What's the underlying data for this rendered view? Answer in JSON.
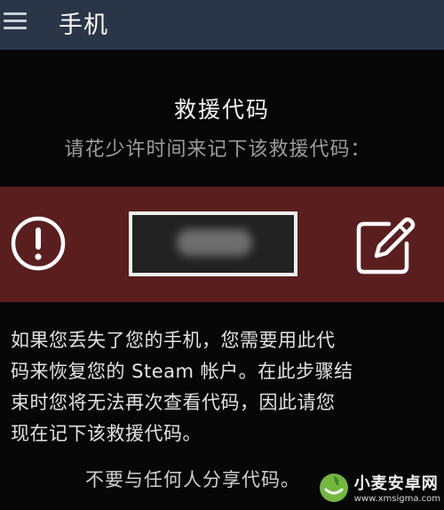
{
  "header": {
    "title": "手机",
    "menu_icon": "hamburger-menu-icon"
  },
  "recovery": {
    "heading": "救援代码",
    "instruction": "请花少许时间来记下该救援代码：",
    "code_value": "",
    "warning_icon": "exclamation-circle-icon",
    "edit_icon": "edit-pencil-icon",
    "band_color": "#5a1e1e"
  },
  "body": {
    "lines": [
      "如果您丢失了您的手机，您需要用此代",
      "码来恢复您的 Steam 帐户。在此步骤结",
      "束时您将无法再次查看代码，因此请您",
      "现在记下该救援代码。"
    ],
    "share_note": "不要与任何人分享代码。"
  },
  "watermark": {
    "name": "小麦安卓网",
    "url": "www.xmsigma.com"
  }
}
